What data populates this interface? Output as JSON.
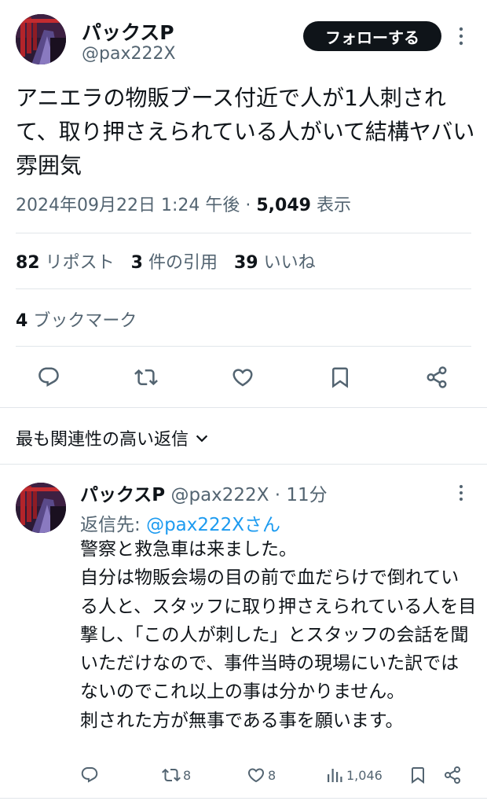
{
  "post": {
    "author_name": "パックスP",
    "author_handle": "@pax222X",
    "follow_label": "フォローする",
    "text": "アニエラの物販ブース付近で人が1人刺されて、取り押さえられている人がいて結構ヤバい雰囲気",
    "timestamp": "2024年09月22日 1:24 午後",
    "separator": "·",
    "views_count": "5,049",
    "views_label": "表示",
    "reposts_count": "82",
    "reposts_label": "リポスト",
    "quotes_count": "3",
    "quotes_label": "件の引用",
    "likes_count": "39",
    "likes_label": "いいね",
    "bookmarks_count": "4",
    "bookmarks_label": "ブックマーク"
  },
  "replies_sort": {
    "label": "最も関連性の高い返信"
  },
  "reply": {
    "author_name": "パックスP",
    "author_handle": "@pax222X",
    "separator": "·",
    "time": "11分",
    "reply_to_prefix": "返信先:",
    "reply_to_handle": "@pax222Xさん",
    "text": "警察と救急車は来ました。\n自分は物販会場の目の前で血だらけで倒れている人と、スタッフに取り押さえられている人を目撃し、「この人が刺した」とスタッフの会話を聞いただけなので、事件当時の現場にいた訳ではないのでこれ以上の事は分かりません。\n刺された方が無事である事を願います。",
    "repost_count": "8",
    "like_count": "8",
    "view_count": "1,046"
  },
  "colors": {
    "text": "#0f1419",
    "muted": "#536471",
    "link": "#1d9bf0",
    "divider": "#e1e6ea",
    "button_bg": "#0f1419"
  },
  "icons": [
    "more-icon",
    "reply-icon",
    "repost-icon",
    "like-icon",
    "bookmark-icon",
    "share-icon",
    "chevron-down-icon",
    "views-icon"
  ]
}
